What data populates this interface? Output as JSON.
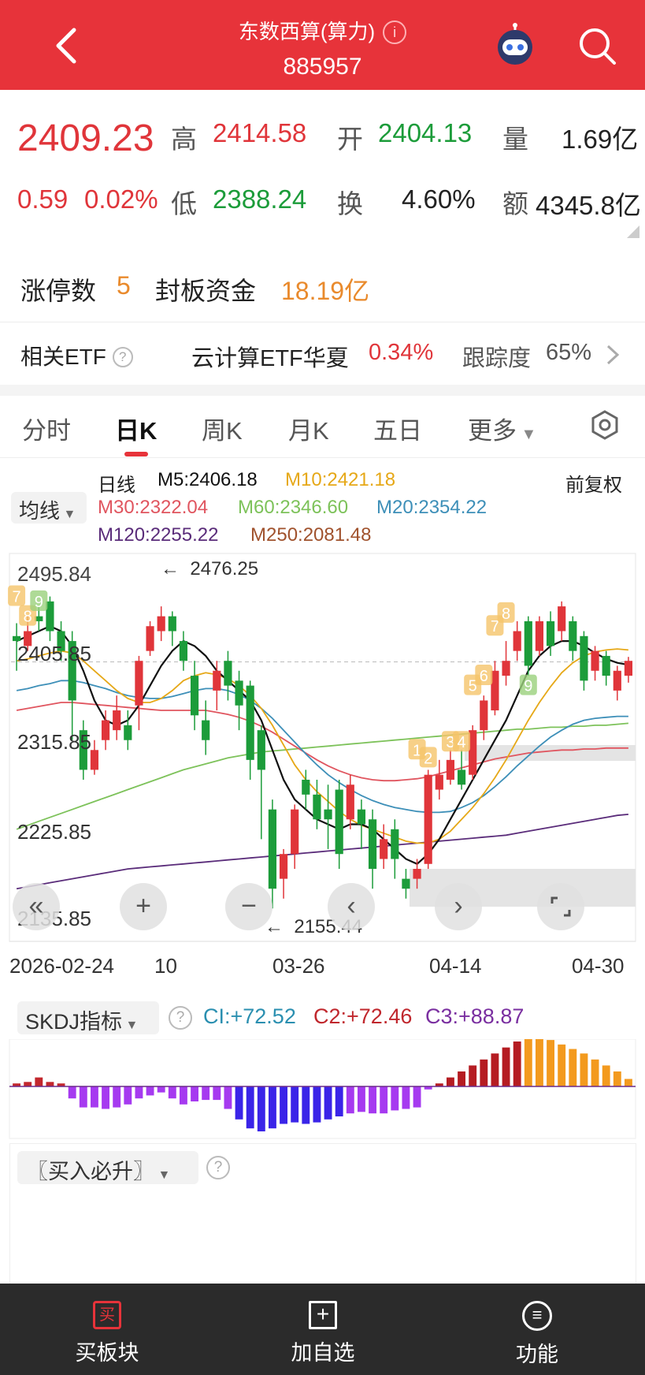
{
  "header": {
    "title": "东数西算(算力)",
    "info_icon": "i",
    "code": "885957"
  },
  "quote": {
    "price": "2409.23",
    "change": "0.59",
    "change_pct": "0.02%",
    "high_label": "高",
    "high": "2414.58",
    "open_label": "开",
    "open": "2404.13",
    "volume_label": "量",
    "volume": "1.69亿",
    "low_label": "低",
    "low": "2388.24",
    "turnover_label": "换",
    "turnover": "4.60%",
    "amount_label": "额",
    "amount": "4345.8亿",
    "limit_up_label": "涨停数",
    "limit_up": "5",
    "seal_label": "封板资金",
    "seal": "18.19亿"
  },
  "etf": {
    "label": "相关ETF",
    "name": "云计算ETF华夏",
    "change": "0.34%",
    "track_label": "跟踪度",
    "track": "65%"
  },
  "tabs": [
    "分时",
    "日K",
    "周K",
    "月K",
    "五日",
    "更多"
  ],
  "active_tab": "日K",
  "ma": {
    "selector": "均线",
    "title": "日线",
    "m5": "M5:2406.18",
    "m10": "M10:2421.18",
    "adjust": "前复权",
    "m30": "M30:2322.04",
    "m60": "M60:2346.60",
    "m20": "M20:2354.22",
    "m120": "M120:2255.22",
    "m250": "M250:2081.48"
  },
  "colors": {
    "up": "#e0353a",
    "down": "#1c9c3a",
    "m5": "#111111",
    "m10": "#e6a817",
    "m20": "#3d8fb8",
    "m30": "#e0555f",
    "m60": "#7dc25a",
    "m120": "#5a2c7a",
    "m250": "#a0522d"
  },
  "chart_data": {
    "type": "candlestick",
    "y_ticks": [
      "2405.85",
      "2315.85",
      "2225.85",
      "2135.85"
    ],
    "y_top_label": "2495.84",
    "ylim": [
      2135.85,
      2495.84
    ],
    "x_labels": [
      "2026-02-24",
      "10",
      "03-26",
      "04-14",
      "04-30"
    ],
    "max_label": "2476.25",
    "min_label": "2155.44",
    "sequence_marks": [
      "7",
      "8",
      "9",
      "1",
      "2",
      "3",
      "4",
      "5",
      "6",
      "7",
      "8",
      "9"
    ],
    "candles": [
      [
        2435,
        2430,
        2448,
        2400
      ],
      [
        2425,
        2440,
        2455,
        2420
      ],
      [
        2455,
        2450,
        2465,
        2440
      ],
      [
        2470,
        2440,
        2475,
        2430
      ],
      [
        2440,
        2420,
        2450,
        2410
      ],
      [
        2430,
        2370,
        2440,
        2330
      ],
      [
        2340,
        2300,
        2350,
        2290
      ],
      [
        2300,
        2320,
        2330,
        2295
      ],
      [
        2330,
        2350,
        2360,
        2320
      ],
      [
        2340,
        2360,
        2375,
        2330
      ],
      [
        2345,
        2330,
        2360,
        2320
      ],
      [
        2365,
        2410,
        2415,
        2340
      ],
      [
        2420,
        2445,
        2450,
        2415
      ],
      [
        2440,
        2455,
        2465,
        2430
      ],
      [
        2455,
        2440,
        2460,
        2425
      ],
      [
        2430,
        2410,
        2440,
        2400
      ],
      [
        2395,
        2355,
        2410,
        2340
      ],
      [
        2350,
        2330,
        2370,
        2315
      ],
      [
        2380,
        2400,
        2410,
        2360
      ],
      [
        2410,
        2385,
        2420,
        2370
      ],
      [
        2390,
        2365,
        2400,
        2340
      ],
      [
        2385,
        2310,
        2390,
        2290
      ],
      [
        2340,
        2300,
        2345,
        2230
      ],
      [
        2260,
        2180,
        2270,
        2160
      ],
      [
        2190,
        2215,
        2220,
        2170
      ],
      [
        2215,
        2260,
        2265,
        2200
      ],
      [
        2290,
        2275,
        2300,
        2260
      ],
      [
        2275,
        2250,
        2290,
        2240
      ],
      [
        2260,
        2250,
        2285,
        2220
      ],
      [
        2280,
        2215,
        2290,
        2200
      ],
      [
        2250,
        2285,
        2295,
        2240
      ],
      [
        2260,
        2245,
        2270,
        2220
      ],
      [
        2250,
        2200,
        2260,
        2180
      ],
      [
        2210,
        2230,
        2245,
        2200
      ],
      [
        2240,
        2210,
        2250,
        2190
      ],
      [
        2190,
        2180,
        2200,
        2170
      ],
      [
        2190,
        2200,
        2210,
        2180
      ],
      [
        2205,
        2295,
        2300,
        2200
      ],
      [
        2280,
        2295,
        2310,
        2270
      ],
      [
        2290,
        2310,
        2320,
        2285
      ],
      [
        2300,
        2285,
        2320,
        2280
      ],
      [
        2295,
        2340,
        2345,
        2290
      ],
      [
        2340,
        2370,
        2375,
        2330
      ],
      [
        2360,
        2400,
        2410,
        2355
      ],
      [
        2395,
        2410,
        2430,
        2385
      ],
      [
        2420,
        2440,
        2450,
        2410
      ],
      [
        2450,
        2405,
        2455,
        2395
      ],
      [
        2420,
        2450,
        2455,
        2415
      ],
      [
        2450,
        2425,
        2460,
        2415
      ],
      [
        2440,
        2465,
        2470,
        2430
      ],
      [
        2450,
        2420,
        2455,
        2410
      ],
      [
        2435,
        2390,
        2440,
        2380
      ],
      [
        2400,
        2420,
        2425,
        2390
      ],
      [
        2415,
        2395,
        2420,
        2385
      ],
      [
        2380,
        2400,
        2405,
        2370
      ],
      [
        2395,
        2410,
        2414,
        2388
      ]
    ],
    "ma5": [
      2430,
      2435,
      2440,
      2445,
      2440,
      2425,
      2400,
      2370,
      2350,
      2345,
      2350,
      2365,
      2385,
      2405,
      2420,
      2430,
      2425,
      2415,
      2400,
      2390,
      2380,
      2370,
      2350,
      2320,
      2290,
      2270,
      2260,
      2250,
      2245,
      2240,
      2245,
      2245,
      2240,
      2230,
      2220,
      2210,
      2205,
      2215,
      2230,
      2250,
      2270,
      2290,
      2310,
      2330,
      2350,
      2375,
      2400,
      2415,
      2425,
      2430,
      2430,
      2425,
      2418,
      2412,
      2408,
      2406
    ],
    "ma10": [
      2410,
      2412,
      2415,
      2418,
      2420,
      2418,
      2410,
      2400,
      2390,
      2380,
      2372,
      2368,
      2368,
      2372,
      2380,
      2390,
      2395,
      2398,
      2396,
      2392,
      2385,
      2375,
      2362,
      2345,
      2325,
      2305,
      2290,
      2278,
      2268,
      2258,
      2250,
      2244,
      2240,
      2236,
      2232,
      2228,
      2226,
      2226,
      2230,
      2238,
      2250,
      2262,
      2276,
      2292,
      2310,
      2330,
      2350,
      2368,
      2384,
      2398,
      2408,
      2415,
      2419,
      2421,
      2422,
      2421
    ],
    "ma20": [
      2380,
      2382,
      2385,
      2387,
      2390,
      2390,
      2388,
      2385,
      2382,
      2378,
      2375,
      2373,
      2372,
      2372,
      2374,
      2377,
      2380,
      2382,
      2382,
      2380,
      2376,
      2370,
      2362,
      2352,
      2340,
      2328,
      2316,
      2305,
      2295,
      2287,
      2280,
      2274,
      2269,
      2265,
      2262,
      2260,
      2258,
      2257,
      2257,
      2258,
      2262,
      2267,
      2274,
      2283,
      2293,
      2304,
      2314,
      2324,
      2333,
      2340,
      2346,
      2350,
      2352,
      2353,
      2354,
      2354
    ],
    "ma30": [
      2360,
      2362,
      2364,
      2366,
      2368,
      2368,
      2367,
      2366,
      2365,
      2364,
      2363,
      2362,
      2361,
      2360,
      2360,
      2360,
      2360,
      2360,
      2358,
      2356,
      2353,
      2349,
      2344,
      2338,
      2331,
      2324,
      2317,
      2310,
      2304,
      2299,
      2295,
      2292,
      2290,
      2289,
      2289,
      2290,
      2291,
      2293,
      2296,
      2299,
      2302,
      2305,
      2308,
      2311,
      2313,
      2315,
      2317,
      2318,
      2319,
      2320,
      2320,
      2321,
      2321,
      2322,
      2322,
      2322
    ],
    "ma60": [
      2240,
      2244,
      2248,
      2252,
      2256,
      2260,
      2264,
      2268,
      2272,
      2276,
      2280,
      2284,
      2288,
      2292,
      2296,
      2300,
      2303,
      2306,
      2309,
      2312,
      2314,
      2316,
      2318,
      2319,
      2320,
      2321,
      2322,
      2323,
      2324,
      2325,
      2326,
      2327,
      2328,
      2329,
      2330,
      2331,
      2332,
      2333,
      2334,
      2335,
      2336,
      2337,
      2338,
      2339,
      2340,
      2341,
      2341,
      2342,
      2343,
      2343,
      2344,
      2344,
      2345,
      2345,
      2346,
      2347
    ],
    "ma120": [
      2180,
      2182,
      2184,
      2186,
      2188,
      2190,
      2192,
      2194,
      2196,
      2198,
      2200,
      2201,
      2202,
      2203,
      2204,
      2205,
      2206,
      2207,
      2208,
      2209,
      2210,
      2211,
      2212,
      2213,
      2214,
      2215,
      2216,
      2217,
      2218,
      2219,
      2220,
      2221,
      2222,
      2223,
      2224,
      2225,
      2226,
      2227,
      2228,
      2229,
      2230,
      2231,
      2232,
      2233,
      2234,
      2236,
      2238,
      2240,
      2242,
      2244,
      2246,
      2248,
      2250,
      2252,
      2254,
      2255
    ]
  },
  "indicator": {
    "name": "SKDJ指标",
    "ci": "CI:+72.52",
    "c2": "C2:+72.46",
    "c3": "C3:+88.87",
    "bars": [
      2,
      3,
      6,
      3,
      2,
      -8,
      -14,
      -14,
      -15,
      -14,
      -12,
      -8,
      -6,
      -4,
      -8,
      -12,
      -10,
      -9,
      -9,
      -15,
      -22,
      -28,
      -30,
      -28,
      -25,
      -24,
      -25,
      -24,
      -22,
      -20,
      -18,
      -17,
      -18,
      -18,
      -16,
      -15,
      -14,
      -2,
      2,
      6,
      10,
      14,
      18,
      22,
      26,
      30,
      33,
      33,
      31,
      28,
      25,
      22,
      18,
      14,
      10,
      5
    ]
  },
  "sub2": {
    "name": "〖买入必升〗"
  },
  "bottom": {
    "buy": "买板块",
    "add": "加自选",
    "func": "功能"
  }
}
